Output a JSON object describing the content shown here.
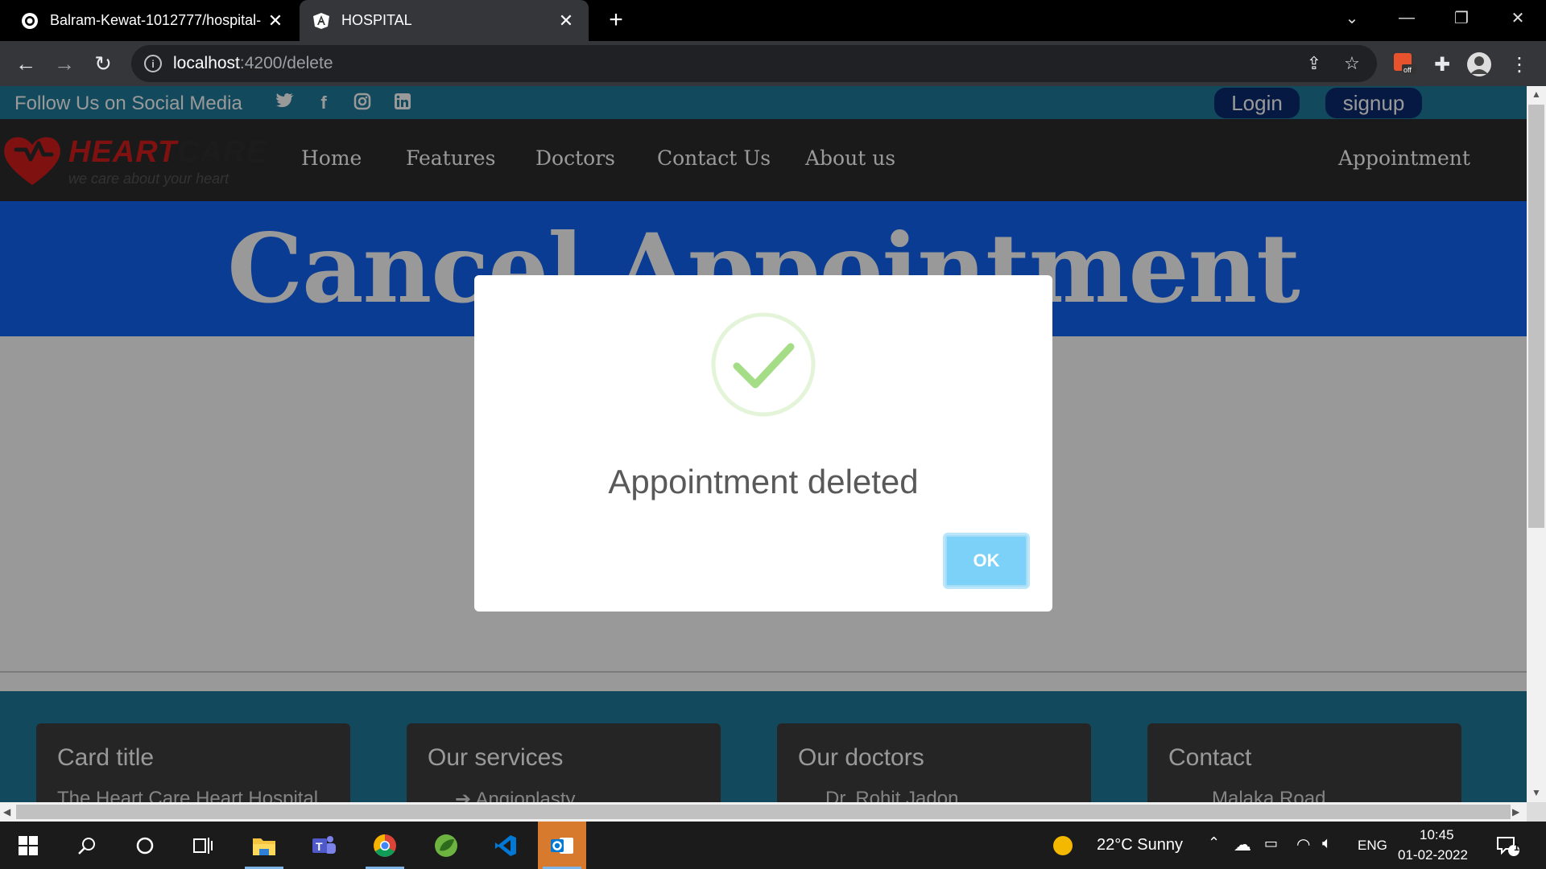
{
  "browser": {
    "tabs": [
      {
        "title": "Balram-Kewat-1012777/hospital-",
        "icon": "github-icon"
      },
      {
        "title": "HOSPITAL",
        "icon": "angular-icon"
      }
    ],
    "url_host": "localhost",
    "url_path": ":4200/delete"
  },
  "social": {
    "text": "Follow Us on Social Media",
    "icons": [
      "twitter-icon",
      "facebook-icon",
      "instagram-icon",
      "linkedin-icon"
    ],
    "login": "Login",
    "signup": "signup"
  },
  "nav": {
    "logo_brand_1": "HEART",
    "logo_brand_2": "CARE",
    "logo_tagline": "we care about your heart",
    "links": [
      "Home",
      "Features",
      "Doctors",
      "Contact Us",
      "About us"
    ],
    "appointment": "Appointment"
  },
  "hero": {
    "title": "Cancel Appointment"
  },
  "footer": {
    "cards": [
      {
        "title": "Card title",
        "line": "The Heart Care Heart Hospital"
      },
      {
        "title": "Our services",
        "line": "Angioplasty"
      },
      {
        "title": "Our doctors",
        "line": "Dr. Rohit Jadon"
      },
      {
        "title": "Contact",
        "line": "Malaka Road..."
      }
    ]
  },
  "modal": {
    "message": "Appointment deleted",
    "ok_label": "OK"
  },
  "taskbar": {
    "weather": "22°C  Sunny",
    "lang": "ENG",
    "time": "10:45",
    "date": "01-02-2022",
    "notifications": "1"
  },
  "colors": {
    "social_bar": "#1f7a99",
    "nav_bg": "#2c2c2c",
    "hero_bg": "#1364f5",
    "brand_red": "#d51d1d",
    "ok_button": "#7cd1f9",
    "check_green": "#a5dc86"
  }
}
